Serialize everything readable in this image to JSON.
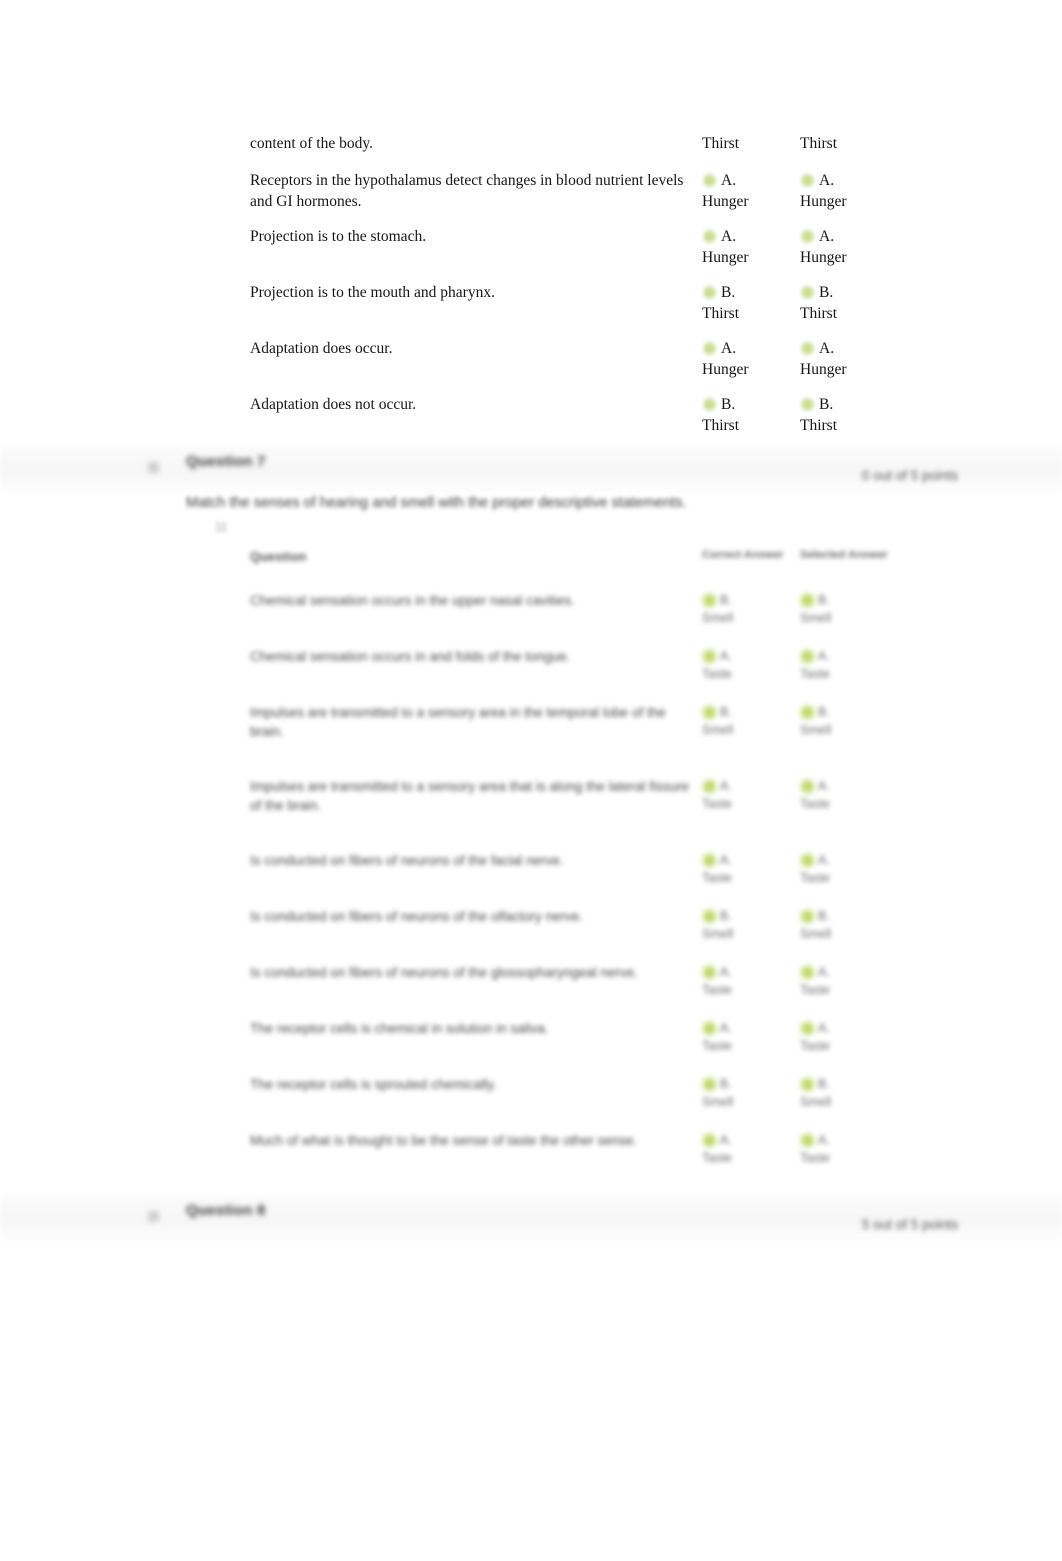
{
  "document": {
    "type": "exam-review-page",
    "background_color": "#ffffff",
    "marker_color": "#c6d87b",
    "marker_color_bright": "#b9cf4c"
  },
  "top_block": {
    "rows": [
      {
        "statement": "content of the body.",
        "correct_answer": {
          "label": "Thirst",
          "marker": false
        },
        "selected_answer": {
          "label": "Thirst",
          "marker": false
        }
      },
      {
        "statement": "Receptors in the hypothalamus detect changes in blood nutrient levels and GI hormones.",
        "correct_answer": {
          "letter": "A.",
          "label": "Hunger",
          "marker": true
        },
        "selected_answer": {
          "letter": "A.",
          "label": "Hunger",
          "marker": true
        }
      },
      {
        "statement": "Projection is to the stomach.",
        "correct_answer": {
          "letter": "A.",
          "label": "Hunger",
          "marker": true
        },
        "selected_answer": {
          "letter": "A.",
          "label": "Hunger",
          "marker": true
        }
      },
      {
        "statement": "Projection is to the mouth and pharynx.",
        "correct_answer": {
          "letter": "B.",
          "label": "Thirst",
          "marker": true
        },
        "selected_answer": {
          "letter": "B.",
          "label": "Thirst",
          "marker": true
        }
      },
      {
        "statement": "Adaptation does occur.",
        "correct_answer": {
          "letter": "A.",
          "label": "Hunger",
          "marker": true
        },
        "selected_answer": {
          "letter": "A.",
          "label": "Hunger",
          "marker": true
        }
      },
      {
        "statement": "Adaptation does not occur.",
        "correct_answer": {
          "letter": "B.",
          "label": "Thirst",
          "marker": true
        },
        "selected_answer": {
          "letter": "B.",
          "label": "Thirst",
          "marker": true
        }
      }
    ]
  },
  "question_section": {
    "header_title": "Question 7",
    "points": "0 out of 5 points",
    "prompt": "Match the senses of hearing and smell with the proper descriptive statements.",
    "prompt_sub": "11",
    "table": {
      "headers": {
        "statement": "Question",
        "correct": "Correct Answer",
        "selected": "Selected Answer"
      },
      "rows": [
        {
          "statement": "Chemical sensation occurs in the upper nasal cavities.",
          "correct_answer": {
            "letter": "B.",
            "label": "Smell",
            "marker": true
          },
          "selected_answer": {
            "letter": "B.",
            "label": "Smell",
            "marker": true
          }
        },
        {
          "statement": "Chemical sensation occurs in and folds of the tongue.",
          "correct_answer": {
            "letter": "A.",
            "label": "Taste",
            "marker": true
          },
          "selected_answer": {
            "letter": "A.",
            "label": "Taste",
            "marker": true
          }
        },
        {
          "statement": "Impulses are transmitted to a sensory area in the temporal lobe of the brain.",
          "correct_answer": {
            "letter": "B.",
            "label": "Smell",
            "marker": true
          },
          "selected_answer": {
            "letter": "B.",
            "label": "Smell",
            "marker": true
          }
        },
        {
          "statement": "Impulses are transmitted to a sensory area that is along the lateral fissure of the brain.",
          "correct_answer": {
            "letter": "A.",
            "label": "Taste",
            "marker": true
          },
          "selected_answer": {
            "letter": "A.",
            "label": "Taste",
            "marker": true
          }
        },
        {
          "statement": "Is conducted on fibers of neurons of the facial nerve.",
          "correct_answer": {
            "letter": "A.",
            "label": "Taste",
            "marker": true
          },
          "selected_answer": {
            "letter": "A.",
            "label": "Taste",
            "marker": true
          }
        },
        {
          "statement": "Is conducted on fibers of neurons of the olfactory nerve.",
          "correct_answer": {
            "letter": "B.",
            "label": "Smell",
            "marker": true
          },
          "selected_answer": {
            "letter": "B.",
            "label": "Smell",
            "marker": true
          }
        },
        {
          "statement": "Is conducted on fibers of neurons of the glossopharyngeal nerve.",
          "correct_answer": {
            "letter": "A.",
            "label": "Taste",
            "marker": true
          },
          "selected_answer": {
            "letter": "A.",
            "label": "Taste",
            "marker": true
          }
        },
        {
          "statement": "The receptor cells is chemical in solution in saliva.",
          "correct_answer": {
            "letter": "A.",
            "label": "Taste",
            "marker": true
          },
          "selected_answer": {
            "letter": "A.",
            "label": "Taste",
            "marker": true
          }
        },
        {
          "statement": "The receptor cells is sprouted chemically.",
          "correct_answer": {
            "letter": "B.",
            "label": "Smell",
            "marker": true
          },
          "selected_answer": {
            "letter": "B.",
            "label": "Smell",
            "marker": true
          }
        },
        {
          "statement": "Much of what is thought to be the sense of taste the other sense.",
          "correct_answer": {
            "letter": "A.",
            "label": "Taste",
            "marker": true
          },
          "selected_answer": {
            "letter": "A.",
            "label": "Taste",
            "marker": true
          }
        }
      ]
    }
  },
  "question_section_next": {
    "header_title": "Question 8",
    "points": "5 out of 5 points"
  }
}
